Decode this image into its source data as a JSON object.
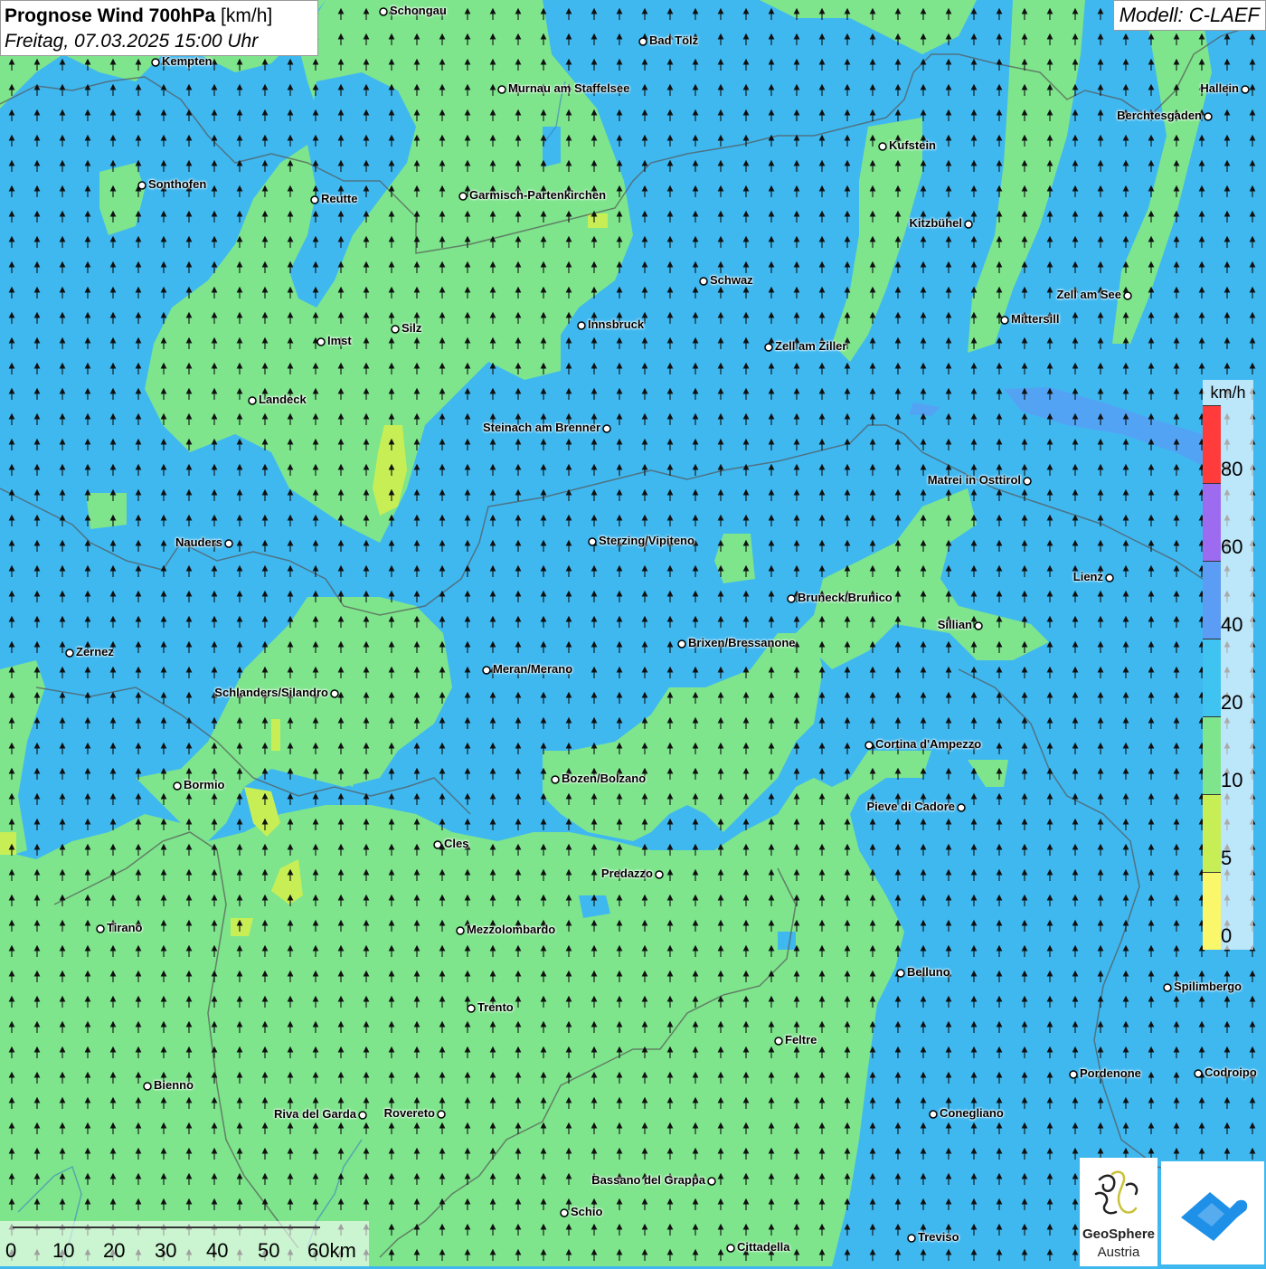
{
  "title": {
    "main": "Prognose Wind 700hPa",
    "unit": "[km/h]",
    "date": "Freitag, 07.03.2025 15:00 Uhr"
  },
  "model": "Modell: C-LAEF",
  "legend": {
    "unit": "km/h",
    "labels": [
      "80",
      "60",
      "40",
      "20",
      "10",
      "5",
      "0"
    ],
    "colors": [
      "#ff3b3b",
      "#9d6bf0",
      "#5b9cf5",
      "#3fc3f0",
      "#7ee58c",
      "#c7ef55",
      "#fbf76b"
    ]
  },
  "scale": {
    "labels": [
      "0",
      "10",
      "20",
      "30",
      "40",
      "50",
      "60km"
    ]
  },
  "logo": {
    "name1": "GeoSphere",
    "name2": "Austria"
  },
  "colors": {
    "calm_5_10": "#c7ef55",
    "light_10_20": "#7ee58c",
    "moderate_20_40": "#3fb8f0",
    "strong_40_60": "#5b9cf5"
  },
  "wind_arrow_direction": "north",
  "cities": [
    {
      "name": "Schongau"
    },
    {
      "name": "Bad Tölz"
    },
    {
      "name": "Kempten"
    },
    {
      "name": "Murnau am Staffelsee"
    },
    {
      "name": "Hallein"
    },
    {
      "name": "Berchtesgaden"
    },
    {
      "name": "Kufstein"
    },
    {
      "name": "Sonthofen"
    },
    {
      "name": "Reutte"
    },
    {
      "name": "Garmisch-Partenkirchen"
    },
    {
      "name": "Kitzbühel"
    },
    {
      "name": "Schwaz"
    },
    {
      "name": "Zell am See"
    },
    {
      "name": "Mittersill"
    },
    {
      "name": "Innsbruck"
    },
    {
      "name": "Silz"
    },
    {
      "name": "Imst"
    },
    {
      "name": "Zell am Ziller"
    },
    {
      "name": "Landeck"
    },
    {
      "name": "Steinach am Brenner"
    },
    {
      "name": "Matrei in Osttirol"
    },
    {
      "name": "Nauders"
    },
    {
      "name": "Sterzing/Vipiteno"
    },
    {
      "name": "Lienz"
    },
    {
      "name": "Bruneck/Brunico"
    },
    {
      "name": "Sillian"
    },
    {
      "name": "Brixen/Bressanone"
    },
    {
      "name": "Zernez"
    },
    {
      "name": "Meran/Merano"
    },
    {
      "name": "Schlanders/Silandro"
    },
    {
      "name": "Cortina d'Ampezzo"
    },
    {
      "name": "Bozen/Bolzano"
    },
    {
      "name": "Bormio"
    },
    {
      "name": "Pieve di Cadore"
    },
    {
      "name": "Cles"
    },
    {
      "name": "Predazzo"
    },
    {
      "name": "Tirano"
    },
    {
      "name": "Mezzolombardo"
    },
    {
      "name": "Belluno"
    },
    {
      "name": "Spilimbergo"
    },
    {
      "name": "Trento"
    },
    {
      "name": "Feltre"
    },
    {
      "name": "Pordenone"
    },
    {
      "name": "Codroipo"
    },
    {
      "name": "Bienno"
    },
    {
      "name": "Riva del Garda"
    },
    {
      "name": "Rovereto"
    },
    {
      "name": "Conegliano"
    },
    {
      "name": "Bassano del Grappa"
    },
    {
      "name": "Schio"
    },
    {
      "name": "Treviso"
    },
    {
      "name": "Cittadella"
    }
  ]
}
